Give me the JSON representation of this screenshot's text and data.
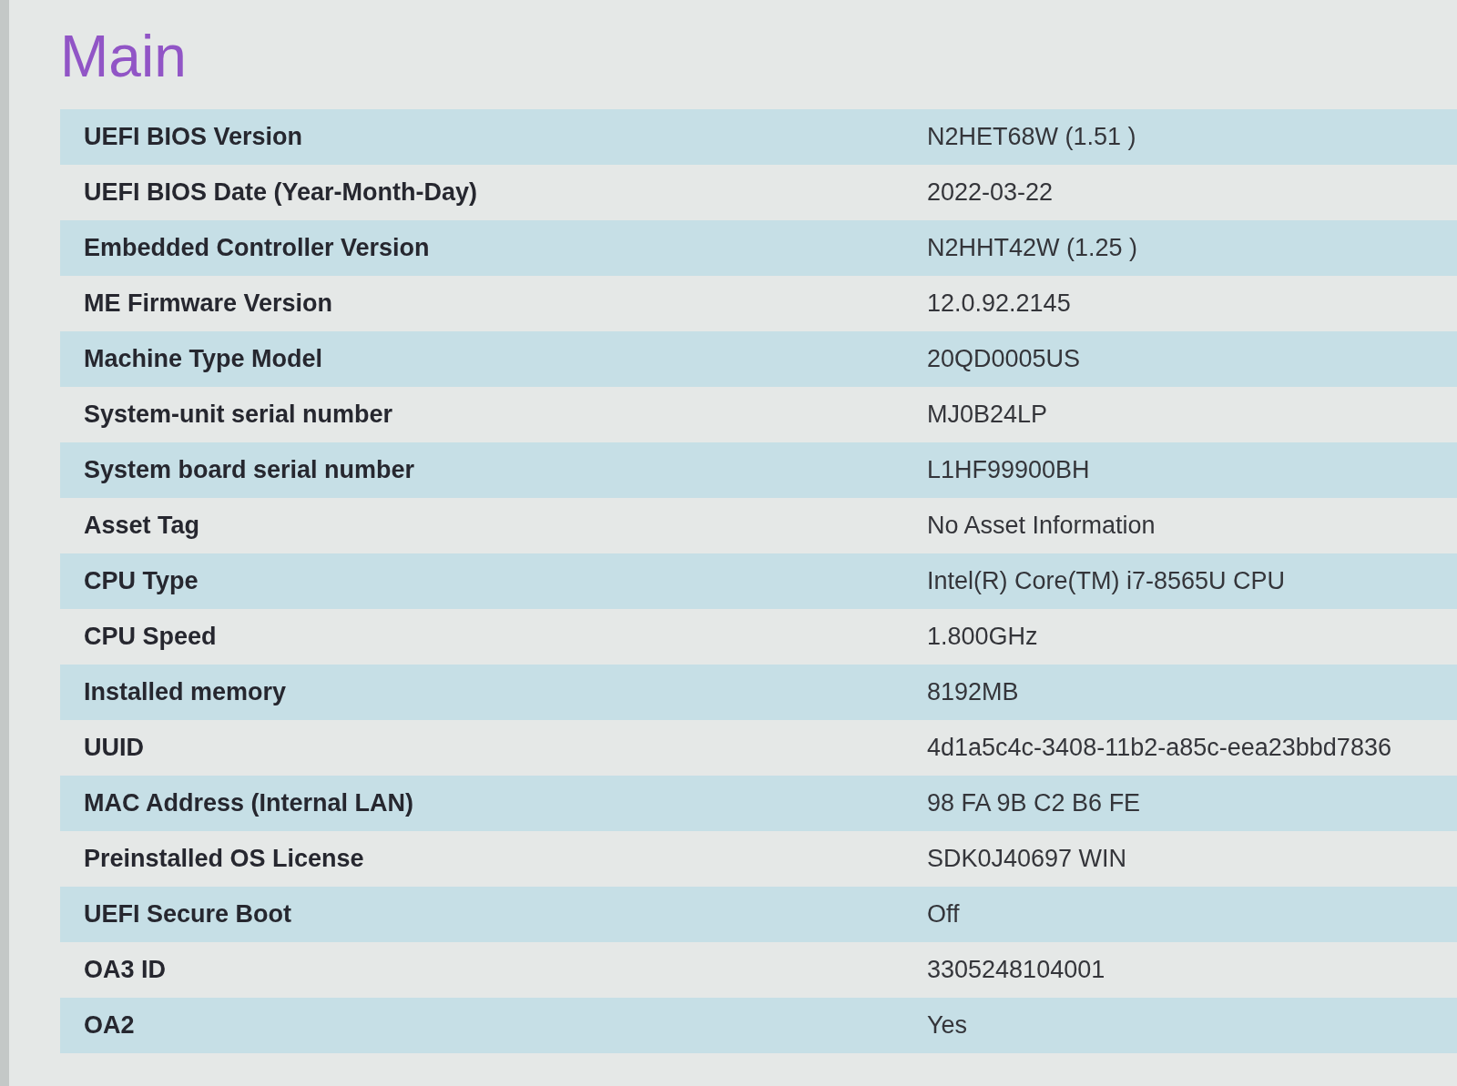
{
  "title": "Main",
  "rows": [
    {
      "label": "UEFI BIOS Version",
      "value": "N2HET68W (1.51 )"
    },
    {
      "label": "UEFI BIOS Date (Year-Month-Day)",
      "value": "2022-03-22"
    },
    {
      "label": "Embedded Controller Version",
      "value": "N2HHT42W (1.25 )"
    },
    {
      "label": "ME Firmware Version",
      "value": "12.0.92.2145"
    },
    {
      "label": "Machine Type Model",
      "value": "20QD0005US"
    },
    {
      "label": "System-unit serial number",
      "value": "MJ0B24LP"
    },
    {
      "label": "System board serial number",
      "value": "L1HF99900BH"
    },
    {
      "label": "Asset Tag",
      "value": "No Asset Information"
    },
    {
      "label": "CPU Type",
      "value": "Intel(R) Core(TM) i7-8565U CPU"
    },
    {
      "label": "CPU Speed",
      "value": "1.800GHz"
    },
    {
      "label": "Installed memory",
      "value": "8192MB"
    },
    {
      "label": "UUID",
      "value": "4d1a5c4c-3408-11b2-a85c-eea23bbd7836"
    },
    {
      "label": "MAC Address (Internal LAN)",
      "value": "98 FA 9B C2 B6 FE"
    },
    {
      "label": "Preinstalled OS License",
      "value": "SDK0J40697 WIN"
    },
    {
      "label": "UEFI Secure Boot",
      "value": "Off"
    },
    {
      "label": "OA3 ID",
      "value": "3305248104001"
    },
    {
      "label": "OA2",
      "value": "Yes"
    }
  ]
}
